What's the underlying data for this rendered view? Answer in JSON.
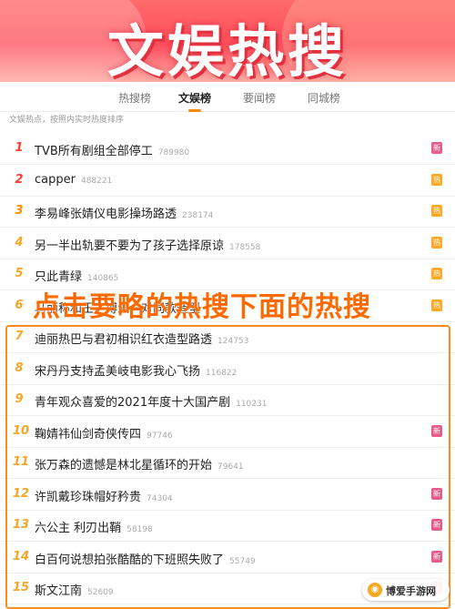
{
  "banner": {
    "title": "文娱热搜"
  },
  "tabs": [
    {
      "label": "热搜榜",
      "active": false
    },
    {
      "label": "文娱榜",
      "active": true
    },
    {
      "label": "要闻榜",
      "active": false
    },
    {
      "label": "同城榜",
      "active": false
    }
  ],
  "subtitle": "文娱热点，按照内实时热度排序",
  "colors": {
    "rank_top": "#ff3b30",
    "rank_mid": "#ff8c00",
    "rank_rest": "#f5a623",
    "badge_new": "#e85c8a",
    "badge_hot": "#ffa726",
    "highlight": "#ff8a1f"
  },
  "items": [
    {
      "rank": "1",
      "title": "TVB所有剧组全部停工",
      "count": "789980",
      "badge": "新",
      "badge_type": "new"
    },
    {
      "rank": "2",
      "title": "capper",
      "count": "488221",
      "badge": "热",
      "badge_type": "hot"
    },
    {
      "rank": "3",
      "title": "李易峰张婧仪电影操场路透",
      "count": "238174",
      "badge": "热",
      "badge_type": "hot"
    },
    {
      "rank": "4",
      "title": "另一半出轨要不要为了孩子选择原谅",
      "count": "178558",
      "badge": "热",
      "badge_type": "hot"
    },
    {
      "rank": "5",
      "title": "只此青绿",
      "count": "140865",
      "badge": "热",
      "badge_type": "hot"
    },
    {
      "rank": "6",
      "title": "马丽称和王一博演一对同款造型",
      "count": "",
      "badge": "热",
      "badge_type": "hot"
    },
    {
      "rank": "7",
      "title": "迪丽热巴与君初相识红衣造型路透",
      "count": "124753",
      "badge": "",
      "badge_type": ""
    },
    {
      "rank": "8",
      "title": "宋丹丹支持孟美岐电影我心飞扬",
      "count": "116822",
      "badge": "",
      "badge_type": ""
    },
    {
      "rank": "9",
      "title": "青年观众喜爱的2021年度十大国产剧",
      "count": "110231",
      "badge": "",
      "badge_type": ""
    },
    {
      "rank": "10",
      "title": "鞠婧祎仙剑奇侠传四",
      "count": "97746",
      "badge": "新",
      "badge_type": "new"
    },
    {
      "rank": "11",
      "title": "张万森的遗憾是林北星循环的开始",
      "count": "79641",
      "badge": "",
      "badge_type": ""
    },
    {
      "rank": "12",
      "title": "许凯戴珍珠帽好矜贵",
      "count": "74304",
      "badge": "新",
      "badge_type": "new"
    },
    {
      "rank": "13",
      "title": "六公主 利刃出鞘",
      "count": "58198",
      "badge": "新",
      "badge_type": "new"
    },
    {
      "rank": "14",
      "title": "白百何说想拍张酷酷的下班照失败了",
      "count": "55749",
      "badge": "新",
      "badge_type": "new"
    },
    {
      "rank": "15",
      "title": "斯文江南",
      "count": "52609",
      "badge": "新",
      "badge_type": "new"
    }
  ],
  "annotation": "点击要略的热搜下面的热搜",
  "watermark": {
    "icon": "game-controller-icon",
    "text": "博爱手游网"
  }
}
